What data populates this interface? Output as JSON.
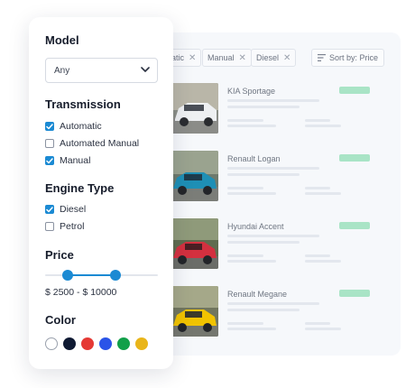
{
  "filters": {
    "model": {
      "title": "Model",
      "selected": "Any"
    },
    "transmission": {
      "title": "Transmission",
      "options": [
        {
          "label": "Automatic",
          "checked": true
        },
        {
          "label": "Automated Manual",
          "checked": false
        },
        {
          "label": "Manual",
          "checked": true
        }
      ]
    },
    "engine": {
      "title": "Engine Type",
      "options": [
        {
          "label": "Diesel",
          "checked": true
        },
        {
          "label": "Petrol",
          "checked": false
        }
      ]
    },
    "price": {
      "title": "Price",
      "range_label": "$ 2500 - $ 10000",
      "min_fraction": 0.2,
      "max_fraction": 0.62
    },
    "color": {
      "title": "Color",
      "swatches": [
        "#ffffff",
        "#0f1a33",
        "#e53935",
        "#2a54e8",
        "#12a04a",
        "#e9b51a"
      ]
    }
  },
  "results": {
    "chips": [
      {
        "label": "atic"
      },
      {
        "label": "Manual"
      },
      {
        "label": "Diesel"
      }
    ],
    "sort_label": "Sort by: Price",
    "cars": [
      {
        "name": "KIA Sportage",
        "body_color": "#eef0f2"
      },
      {
        "name": "Renault Logan",
        "body_color": "#1e8fb5"
      },
      {
        "name": "Hyundai Accent",
        "body_color": "#d3303f"
      },
      {
        "name": "Renault Megane",
        "body_color": "#f1c300"
      }
    ]
  },
  "colors": {
    "accent": "#1b8ad3",
    "price_pill": "#a9e4c6"
  }
}
